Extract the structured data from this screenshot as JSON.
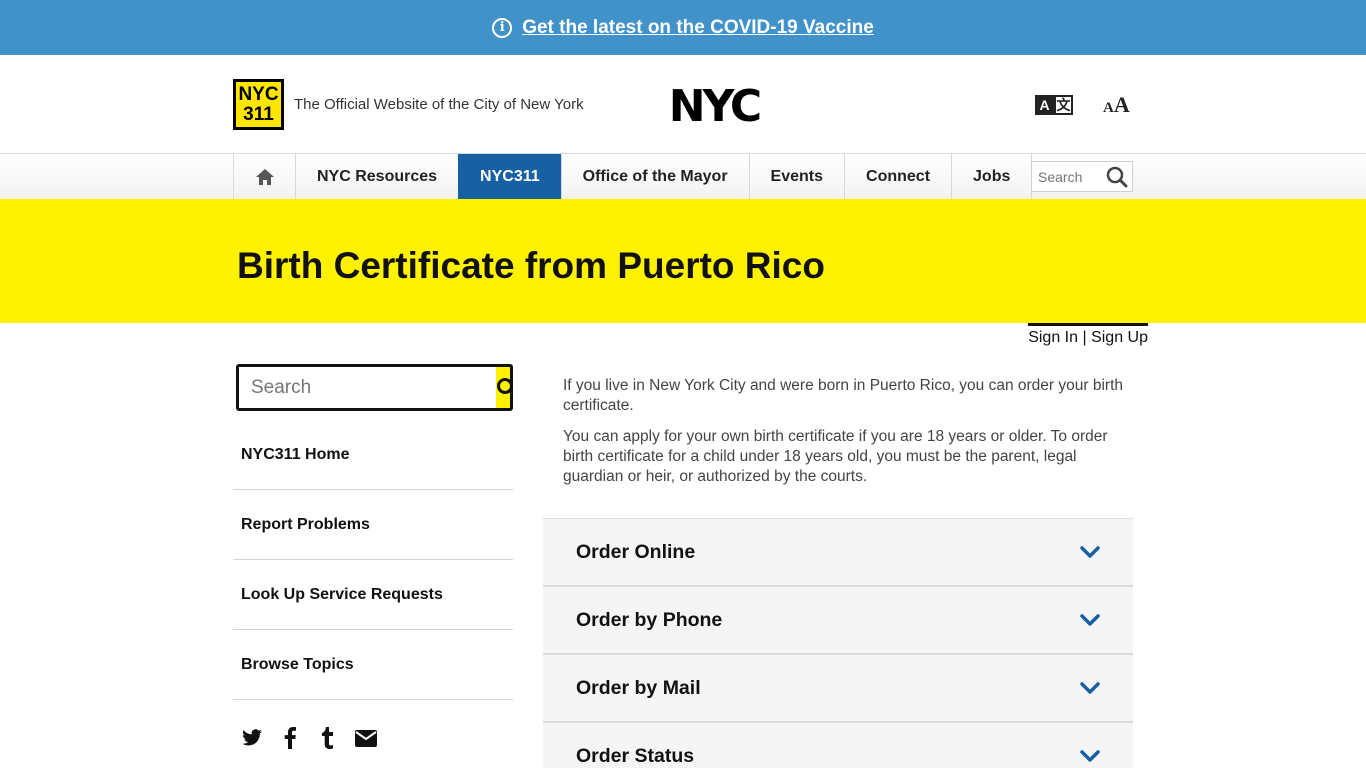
{
  "alert": {
    "text": "Get the latest on the COVID-19 Vaccine"
  },
  "header": {
    "logo_line1": "NYC",
    "logo_line2": "311",
    "official_text": "The Official Website of the City of New York",
    "nyc_logo": "NYC"
  },
  "nav": {
    "items": [
      "NYC Resources",
      "NYC311",
      "Office of the Mayor",
      "Events",
      "Connect",
      "Jobs"
    ],
    "active": "NYC311",
    "search_placeholder": "Search"
  },
  "hero": {
    "title": "Birth Certificate from Puerto Rico"
  },
  "account": {
    "sign_in": "Sign In",
    "separator": "|",
    "sign_up": "Sign Up"
  },
  "sidebar": {
    "search_placeholder": "Search",
    "items": [
      "NYC311 Home",
      "Report Problems",
      "Look Up Service Requests",
      "Browse Topics"
    ],
    "social": [
      "twitter-icon",
      "facebook-icon",
      "tumblr-icon",
      "email-icon"
    ]
  },
  "main": {
    "paragraphs": [
      "If you live in New York City and were born in Puerto Rico, you can order your birth certificate.",
      "You can apply for your own birth certificate if you are 18 years or older. To order birth certificate for a child under 18 years old, you must be the parent, legal guardian or heir, or authorized by the courts."
    ],
    "accordion": [
      "Order Online",
      "Order by Phone",
      "Order by Mail",
      "Order Status"
    ]
  },
  "colors": {
    "alert_bg": "#4192c9",
    "hero_bg": "#fff200",
    "nav_active": "#1760a4",
    "chevron": "#1760a4"
  }
}
